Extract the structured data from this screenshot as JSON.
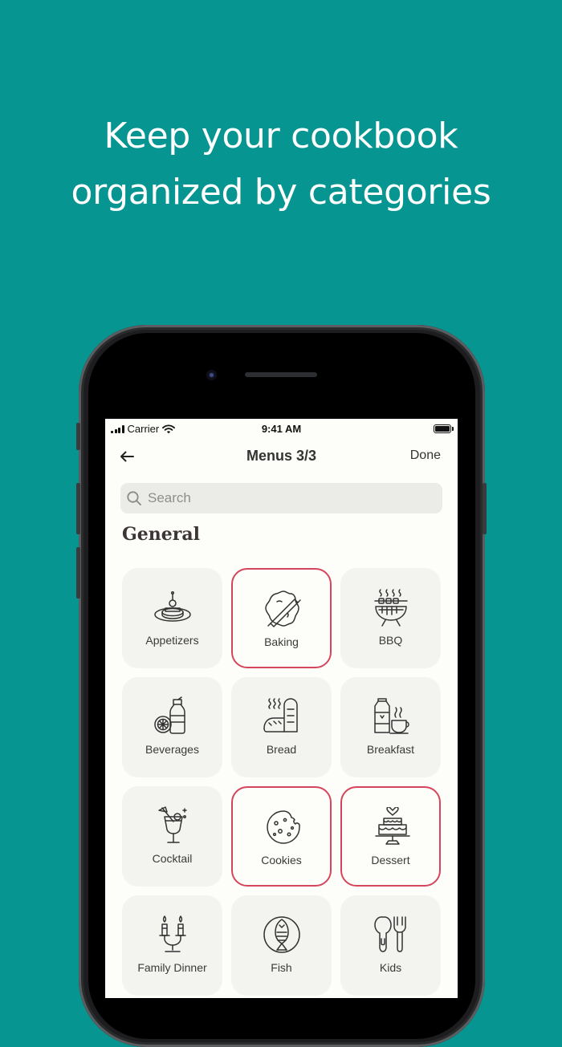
{
  "promo": {
    "headline_line1": "Keep your cookbook",
    "headline_line2": "organized by categories"
  },
  "colors": {
    "background": "#069590",
    "accent_selected": "#d5455b",
    "tile_background": "#f3f3ef",
    "screen_background": "#fdfdfa"
  },
  "status_bar": {
    "carrier": "Carrier",
    "time": "9:41 AM"
  },
  "nav": {
    "back_icon": "arrow-left-icon",
    "title": "Menus 3/3",
    "done_label": "Done"
  },
  "search": {
    "placeholder": "Search",
    "value": ""
  },
  "section": {
    "title": "General"
  },
  "categories": [
    {
      "label": "Appetizers",
      "icon": "appetizer-plate-icon",
      "selected": false
    },
    {
      "label": "Baking",
      "icon": "rolling-pin-dough-icon",
      "selected": true
    },
    {
      "label": "BBQ",
      "icon": "grill-skewer-icon",
      "selected": false
    },
    {
      "label": "Beverages",
      "icon": "bottle-citrus-icon",
      "selected": false
    },
    {
      "label": "Bread",
      "icon": "bread-loaf-icon",
      "selected": false
    },
    {
      "label": "Breakfast",
      "icon": "milk-cup-icon",
      "selected": false
    },
    {
      "label": "Cocktail",
      "icon": "cocktail-glass-icon",
      "selected": false
    },
    {
      "label": "Cookies",
      "icon": "cookie-icon",
      "selected": true
    },
    {
      "label": "Dessert",
      "icon": "cake-icon",
      "selected": true
    },
    {
      "label": "Family Dinner",
      "icon": "candles-icon",
      "selected": false
    },
    {
      "label": "Fish",
      "icon": "fish-plate-icon",
      "selected": false
    },
    {
      "label": "Kids",
      "icon": "kids-cutlery-icon",
      "selected": false
    }
  ]
}
